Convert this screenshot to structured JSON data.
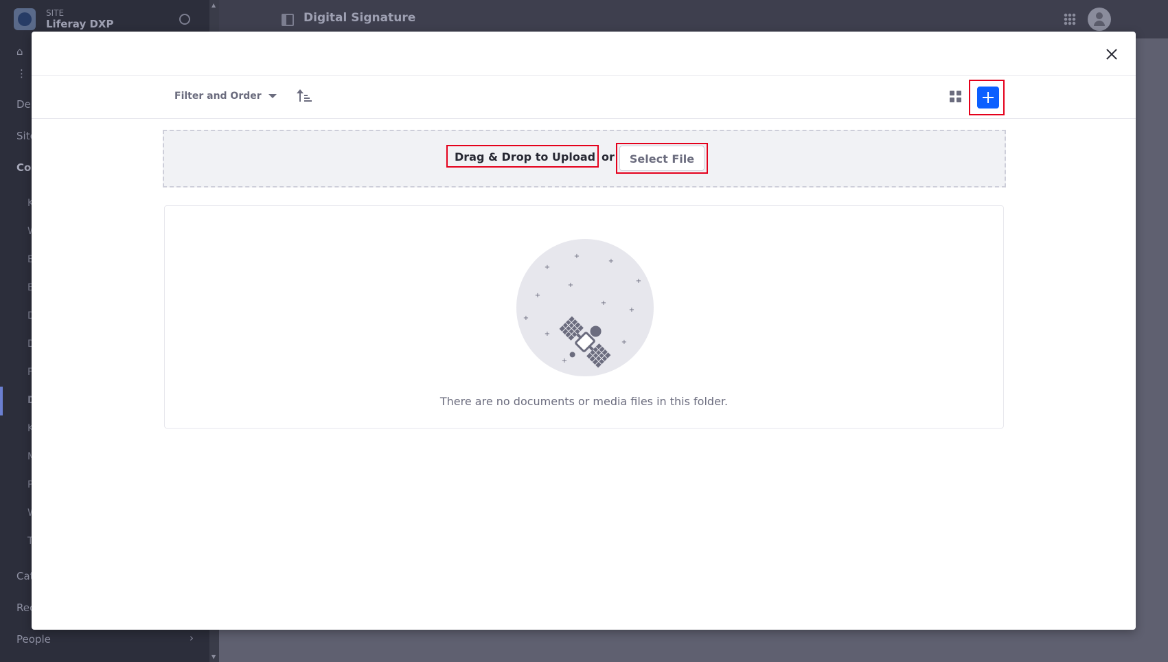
{
  "app": {
    "site_kicker": "SITE",
    "site_name": "Liferay DXP",
    "page_title": "Digital Signature"
  },
  "sidebar": {
    "items": [
      {
        "label": "De"
      },
      {
        "label": "Site"
      },
      {
        "label": "Co"
      },
      {
        "label": "Cat"
      },
      {
        "label": "Rec"
      },
      {
        "label": "People"
      }
    ],
    "sub_items": [
      "K",
      "W",
      "B",
      "B",
      "D",
      "D",
      "F",
      "D",
      "K",
      "M",
      "P",
      "W",
      "T"
    ]
  },
  "modal": {
    "toolbar": {
      "filter_label": "Filter and Order"
    },
    "dropzone": {
      "label": "Drag & Drop to Upload",
      "or_text": "or",
      "select_file_label": "Select File"
    },
    "empty_state": {
      "message": "There are no documents or media files in this folder."
    }
  }
}
